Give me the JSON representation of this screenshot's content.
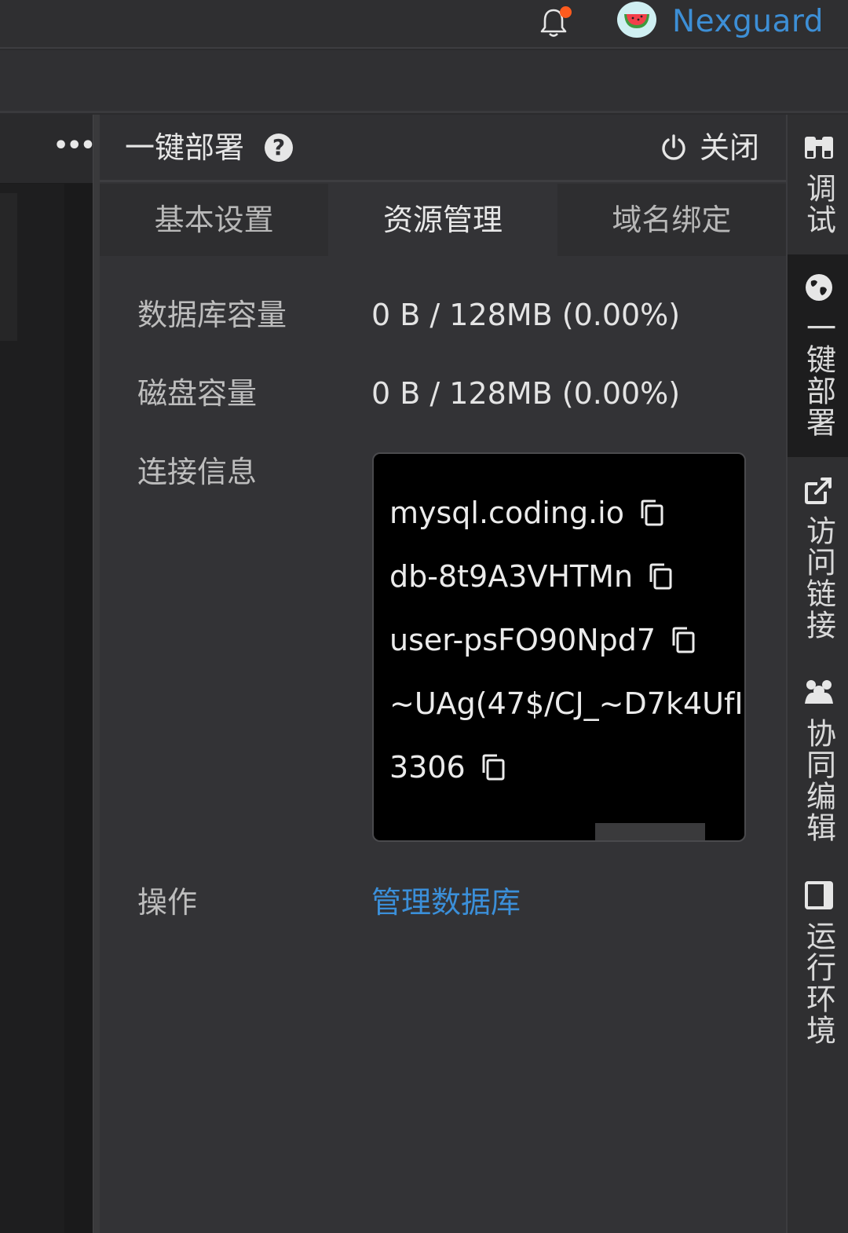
{
  "header": {
    "username": "Nexguard",
    "notification_dot_color": "#ff5b1e",
    "icons": [
      "bell-icon",
      "watermelon-avatar"
    ]
  },
  "panel": {
    "title": "一键部署",
    "close_label": "关闭",
    "tabs": [
      {
        "label": "基本设置",
        "active": false
      },
      {
        "label": "资源管理",
        "active": true
      },
      {
        "label": "域名绑定",
        "active": false
      }
    ],
    "rows": {
      "db_capacity": {
        "label": "数据库容量",
        "value": "0 B / 128MB (0.00%)"
      },
      "disk_capacity": {
        "label": "磁盘容量",
        "value": "0 B / 128MB (0.00%)"
      },
      "connection": {
        "label": "连接信息",
        "host": "mysql.coding.io",
        "database": "db-8t9A3VHTMn",
        "user": "user-psFO90Npd7",
        "password": "~UAg(47$/CJ_~D7k4UfI",
        "port": "3306"
      },
      "actions": {
        "label": "操作",
        "manage_link": "管理数据库"
      }
    }
  },
  "right_toolbar": {
    "items": [
      {
        "label": "调试",
        "icon": "binoculars-icon",
        "active": false
      },
      {
        "label": "一键部署",
        "icon": "globe-icon",
        "active": true
      },
      {
        "label": "访问链接",
        "icon": "external-link-icon",
        "active": false
      },
      {
        "label": "协同编辑",
        "icon": "group-icon",
        "active": false
      },
      {
        "label": "运行环境",
        "icon": "window-icon",
        "active": false
      }
    ]
  },
  "colors": {
    "accent_link": "#3b8fd9",
    "panel_bg": "#333336",
    "code_bg": "#000000"
  }
}
